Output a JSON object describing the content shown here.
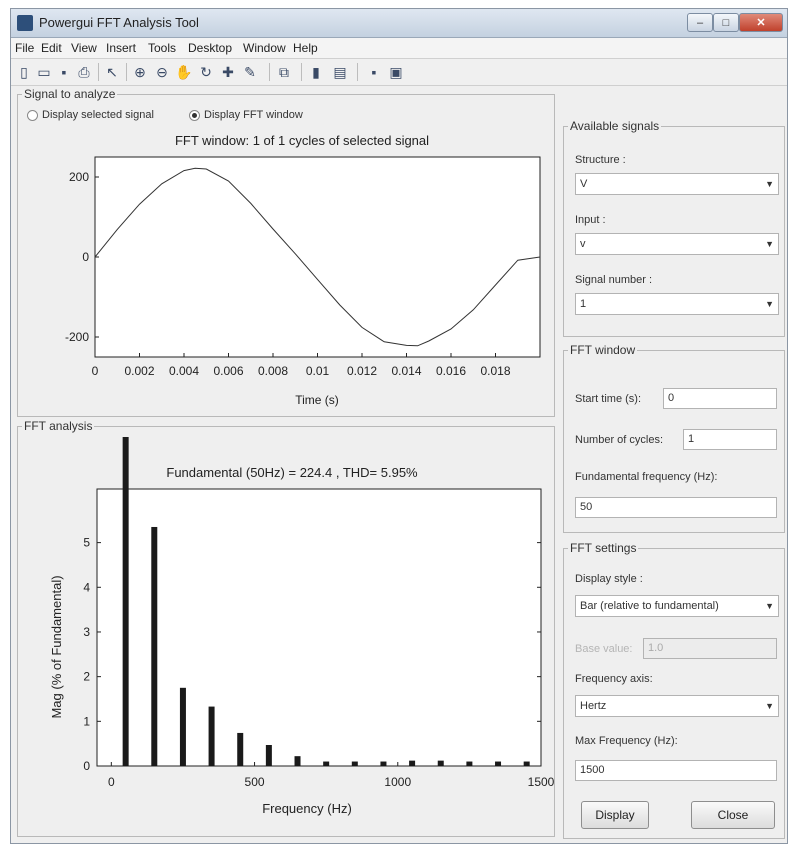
{
  "window": {
    "title": "Powergui FFT Analysis Tool"
  },
  "menubar": [
    "File",
    "Edit",
    "View",
    "Insert",
    "Tools",
    "Desktop",
    "Window",
    "Help"
  ],
  "toolbar_icons": [
    "new-file-icon",
    "open-folder-icon",
    "save-icon",
    "print-icon",
    "pointer-icon",
    "zoom-in-icon",
    "zoom-out-icon",
    "pan-icon",
    "rotate-icon",
    "data-cursor-icon",
    "brush-icon",
    "link-icon",
    "colorbar-icon",
    "legend-icon",
    "hide-plot-tools-icon",
    "show-plot-tools-icon"
  ],
  "signal_panel": {
    "legend": "Signal to analyze",
    "radio_selected_signal": "Display selected signal",
    "radio_fft_window": "Display FFT window",
    "selected_radio": "fft_window"
  },
  "signal_plot": {
    "title": "FFT window: 1 of 1 cycles of selected signal",
    "xlabel": "Time (s)",
    "xticks": [
      "0",
      "0.002",
      "0.004",
      "0.006",
      "0.008",
      "0.01",
      "0.012",
      "0.014",
      "0.016",
      "0.018"
    ],
    "yticks": [
      "200",
      "0",
      "-200"
    ]
  },
  "fft_panel": {
    "legend": "FFT analysis"
  },
  "fft_plot": {
    "title": "Fundamental (50Hz) = 224.4 , THD= 5.95%",
    "xlabel": "Frequency (Hz)",
    "ylabel": "Mag (% of Fundamental)",
    "xticks": [
      "0",
      "500",
      "1000",
      "1500"
    ],
    "yticks": [
      "0",
      "1",
      "2",
      "3",
      "4",
      "5"
    ]
  },
  "available_signals": {
    "legend": "Available signals",
    "structure_label": "Structure :",
    "structure_value": "V",
    "input_label": "Input :",
    "input_value": "v",
    "signal_number_label": "Signal number :",
    "signal_number_value": "1"
  },
  "fft_window": {
    "legend": "FFT window",
    "start_time_label": "Start time (s):",
    "start_time_value": "0",
    "cycles_label": "Number of cycles:",
    "cycles_value": "1",
    "fund_freq_label": "Fundamental frequency (Hz):",
    "fund_freq_value": "50"
  },
  "fft_settings": {
    "legend": "FFT settings",
    "display_style_label": "Display style :",
    "display_style_value": "Bar (relative to fundamental)",
    "base_value_label": "Base value:",
    "base_value": "1.0",
    "freq_axis_label": "Frequency axis:",
    "freq_axis_value": "Hertz",
    "max_freq_label": "Max Frequency (Hz):",
    "max_freq_value": "1500",
    "display_button": "Display",
    "close_button": "Close"
  },
  "chart_data": [
    {
      "type": "line",
      "title": "FFT window: 1 of 1 cycles of selected signal",
      "xlabel": "Time (s)",
      "ylabel": "",
      "xlim": [
        0,
        0.02
      ],
      "ylim": [
        -250,
        250
      ],
      "series": [
        {
          "x": [
            0,
            0.001,
            0.002,
            0.003,
            0.004,
            0.0045,
            0.005,
            0.006,
            0.007,
            0.008,
            0.009,
            0.01,
            0.011,
            0.012,
            0.013,
            0.014,
            0.0145,
            0.015,
            0.016,
            0.017,
            0.018,
            0.019,
            0.02
          ],
          "values": [
            0,
            69,
            132,
            183,
            216,
            222,
            220,
            190,
            134,
            70,
            8,
            -56,
            -120,
            -176,
            -212,
            -221,
            -222,
            -210,
            -180,
            -132,
            -70,
            -8,
            0
          ]
        }
      ]
    },
    {
      "type": "bar",
      "title": "Fundamental (50Hz) = 224.4 , THD= 5.95%",
      "xlabel": "Frequency (Hz)",
      "ylabel": "Mag (% of Fundamental)",
      "xlim": [
        -50,
        1500
      ],
      "ylim": [
        0,
        6.2
      ],
      "grid": false,
      "x": [
        50,
        150,
        250,
        350,
        450,
        550,
        650,
        750,
        850,
        950,
        1050,
        1150,
        1250,
        1350,
        1450
      ],
      "values": [
        100,
        5.35,
        1.75,
        1.33,
        0.74,
        0.47,
        0.22,
        0.1,
        0.1,
        0.1,
        0.12,
        0.12,
        0.1,
        0.1,
        0.1
      ]
    }
  ]
}
